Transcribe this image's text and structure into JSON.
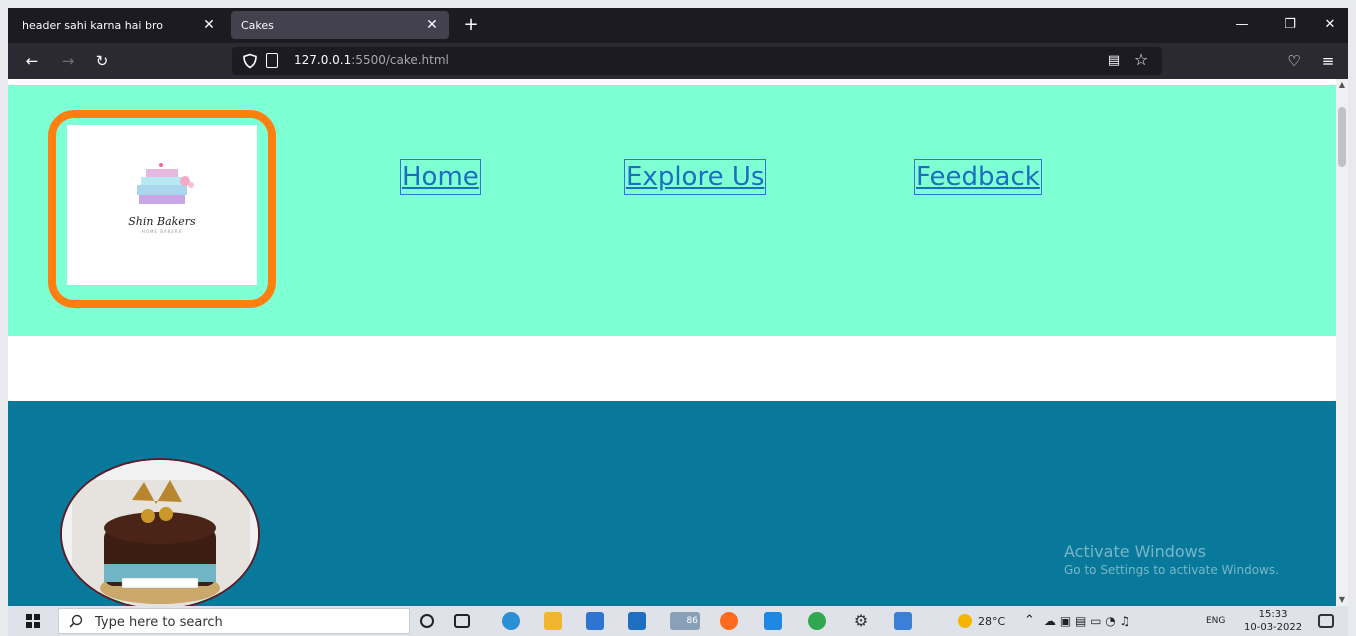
{
  "browser": {
    "tabs": [
      {
        "title": "header sahi karna hai bro",
        "close": "✕",
        "active": false
      },
      {
        "title": "Cakes",
        "close": "✕",
        "active": true
      }
    ],
    "new_tab": "+",
    "window_controls": {
      "minimize": "—",
      "restore": "❐",
      "close": "✕"
    },
    "url_host": "127.0.0.1",
    "url_path": ":5500/cake.html"
  },
  "page": {
    "logo": {
      "name": "Shin Bakers",
      "sub": "HOME BAKERS"
    },
    "nav": [
      {
        "label": "Home"
      },
      {
        "label": "Explore Us"
      },
      {
        "label": "Feedback"
      }
    ],
    "watermark": {
      "line1": "Activate Windows",
      "line2": "Go to Settings to activate Windows."
    }
  },
  "taskbar": {
    "search_placeholder": "Type here to search",
    "weather": "28°C",
    "language": "ENG",
    "time": "15:33",
    "date": "10-03-2022",
    "badge": "86"
  },
  "colors": {
    "header_bg": "#7fffd4",
    "logo_border": "#ff7f11",
    "band_bg": "#08799a",
    "link": "#1a6fbf"
  }
}
